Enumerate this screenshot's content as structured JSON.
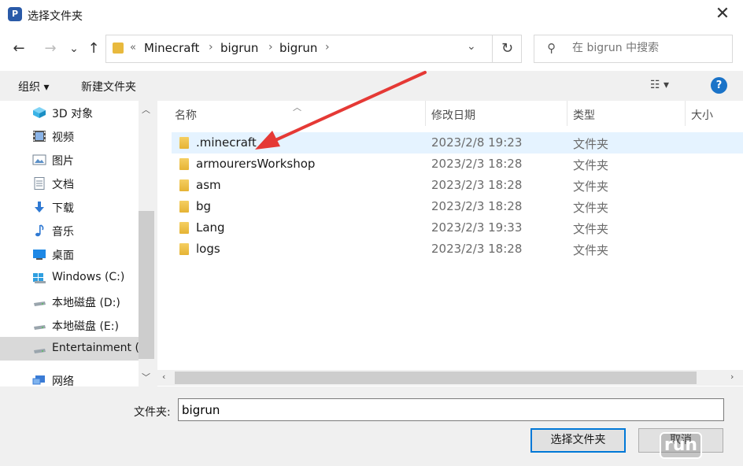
{
  "window": {
    "title": "选择文件夹",
    "app_icon_letter": "P",
    "close": "✕"
  },
  "navigation": {
    "back": "←",
    "forward": "→",
    "recent": "⌄",
    "up": "↑",
    "breadcrumb_overflow": "«",
    "breadcrumbs": [
      "Minecraft",
      "bigrun",
      "bigrun"
    ],
    "separator": "›",
    "dropdown": "⌄",
    "refresh": "↻",
    "search_icon": "⚲",
    "search_placeholder": "在 bigrun 中搜索"
  },
  "toolbar": {
    "organize": "组织 ▾",
    "new_folder": "新建文件夹",
    "view": "☷ ▾",
    "help": "?"
  },
  "sidebar": {
    "items": [
      {
        "label": "3D 对象",
        "icon": "cube-icon",
        "color": "#3bb3e6"
      },
      {
        "label": "视频",
        "icon": "film-icon",
        "color": "#555555"
      },
      {
        "label": "图片",
        "icon": "picture-icon",
        "color": "#5a8fc7"
      },
      {
        "label": "文档",
        "icon": "document-icon",
        "color": "#7a8a9a"
      },
      {
        "label": "下载",
        "icon": "download-icon",
        "color": "#2f79d3"
      },
      {
        "label": "音乐",
        "icon": "music-icon",
        "color": "#2f79d3"
      },
      {
        "label": "桌面",
        "icon": "desktop-icon",
        "color": "#1e88e5"
      },
      {
        "label": "Windows (C:)",
        "icon": "windows-drive-icon",
        "color": "#2f9fe0"
      },
      {
        "label": "本地磁盘 (D:)",
        "icon": "drive-icon",
        "color": "#888888"
      },
      {
        "label": "本地磁盘 (E:)",
        "icon": "drive-icon",
        "color": "#888888"
      },
      {
        "label": "Entertainment (F:)",
        "icon": "drive-icon",
        "color": "#888888"
      },
      {
        "label": "网络",
        "icon": "network-icon",
        "color": "#3a7bd5"
      }
    ]
  },
  "file_list": {
    "columns": {
      "name": "名称",
      "modified": "修改日期",
      "type": "类型",
      "size": "大小"
    },
    "rows": [
      {
        "name": ".minecraft",
        "modified": "2023/2/8 19:23",
        "type": "文件夹"
      },
      {
        "name": "armourersWorkshop",
        "modified": "2023/2/3 18:28",
        "type": "文件夹"
      },
      {
        "name": "asm",
        "modified": "2023/2/3 18:28",
        "type": "文件夹"
      },
      {
        "name": "bg",
        "modified": "2023/2/3 18:28",
        "type": "文件夹"
      },
      {
        "name": "Lang",
        "modified": "2023/2/3 19:33",
        "type": "文件夹"
      },
      {
        "name": "logs",
        "modified": "2023/2/3 18:28",
        "type": "文件夹"
      }
    ]
  },
  "footer": {
    "folder_label": "文件夹:",
    "folder_value": "bigrun",
    "select_button": "选择文件夹",
    "cancel_button": "取消",
    "watermark": "run"
  },
  "annotation": {
    "arrow_color": "#e53935"
  }
}
